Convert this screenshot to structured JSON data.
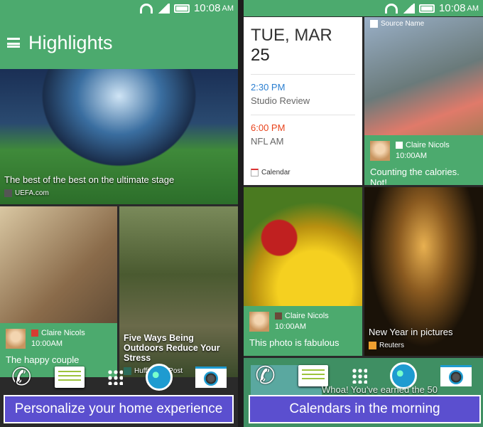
{
  "status": {
    "time": "10:08",
    "ampm": "AM"
  },
  "left": {
    "title": "Highlights",
    "hero": {
      "caption": "The best of the best on the ultimate stage",
      "source": "UEFA.com"
    },
    "social": {
      "name": "Claire Nicols",
      "time": "10:00AM",
      "message": "The happy couple",
      "network": "google-plus"
    },
    "article": {
      "caption": "Five Ways Being Outdoors Reduce Your Stress",
      "source": "Huffington Post"
    },
    "banner": "Personalize your home experience"
  },
  "right": {
    "calendar": {
      "date_prefix": "TUE, MAR",
      "day": "25",
      "events": [
        {
          "time": "2:30 PM",
          "name": "Studio Review",
          "color": "#2b7fd1"
        },
        {
          "time": "6:00 PM",
          "name": "NFL AM",
          "color": "#e8431c"
        }
      ],
      "app": "Calendar"
    },
    "photo": {
      "source": "Source Name",
      "name": "Claire Nicols",
      "time": "10:00AM",
      "message": "Counting the calories. Not!",
      "network": "flickr"
    },
    "social": {
      "name": "Claire Nicols",
      "time": "10:00AM",
      "message": "This photo is fabulous",
      "network": "instagram"
    },
    "article": {
      "caption": "New Year in pictures",
      "source": "Reuters"
    },
    "behind_text": "Whoa! You've earned the 50",
    "banner": "Calendars in the morning"
  },
  "colors": {
    "accent": "#4caa6e",
    "banner": "#5b4fcf"
  },
  "dock_icons": [
    "phone-icon",
    "messages-icon",
    "app-drawer-icon",
    "browser-icon",
    "camera-icon"
  ]
}
